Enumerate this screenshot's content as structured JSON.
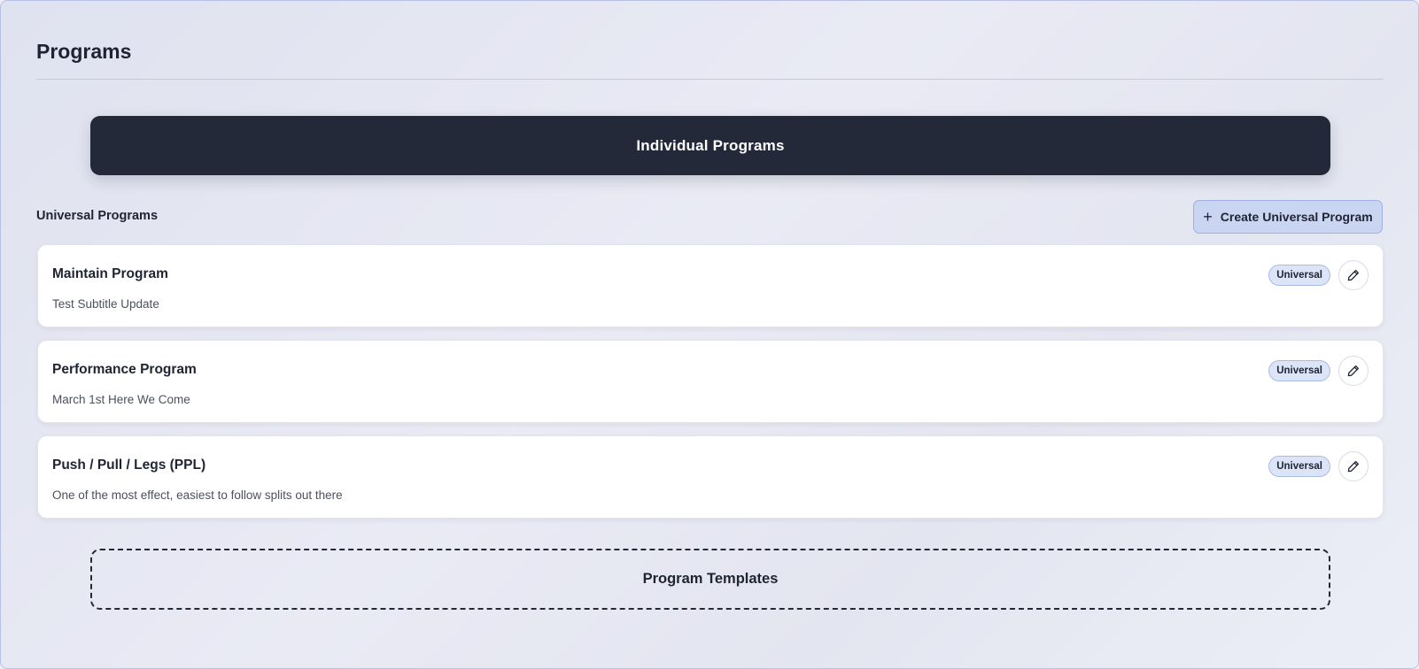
{
  "header": {
    "title": "Programs"
  },
  "individual_programs": {
    "label": "Individual Programs"
  },
  "universal_section": {
    "label": "Universal Programs",
    "create_button_icon": "plus-icon",
    "create_button_label": "Create Universal Program"
  },
  "programs": [
    {
      "title": "Maintain Program",
      "subtitle": "Test Subtitle Update",
      "badge": "Universal",
      "edit_icon": "pencil-icon"
    },
    {
      "title": "Performance Program",
      "subtitle": "March 1st Here We Come",
      "badge": "Universal",
      "edit_icon": "pencil-icon"
    },
    {
      "title": "Push / Pull / Legs (PPL)",
      "subtitle": "One of the most effect, easiest to follow splits out there",
      "badge": "Universal",
      "edit_icon": "pencil-icon"
    }
  ],
  "templates": {
    "label": "Program Templates"
  },
  "colors": {
    "banner_background": "#232939",
    "accent_button": "#c9d5f1",
    "badge_background": "#dce4f8",
    "text_primary": "#1f2433"
  }
}
